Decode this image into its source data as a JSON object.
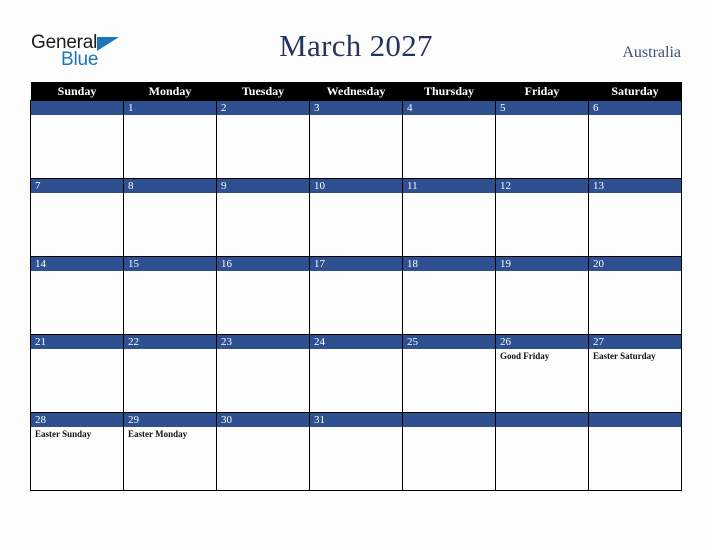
{
  "header": {
    "logo": {
      "top_text": "General",
      "bottom_text": "Blue",
      "triangle_color": "#1b75bc",
      "top_color": "#1c1c1c"
    },
    "title": "March 2027",
    "country": "Australia",
    "title_color": "#27355e"
  },
  "calendar": {
    "weekday_headers": [
      "Sunday",
      "Monday",
      "Tuesday",
      "Wednesday",
      "Thursday",
      "Friday",
      "Saturday"
    ],
    "header_bg": "#000000",
    "daybar_bg": "#2e5090",
    "weeks": [
      [
        {
          "day": "",
          "events": []
        },
        {
          "day": "1",
          "events": []
        },
        {
          "day": "2",
          "events": []
        },
        {
          "day": "3",
          "events": []
        },
        {
          "day": "4",
          "events": []
        },
        {
          "day": "5",
          "events": []
        },
        {
          "day": "6",
          "events": []
        }
      ],
      [
        {
          "day": "7",
          "events": []
        },
        {
          "day": "8",
          "events": []
        },
        {
          "day": "9",
          "events": []
        },
        {
          "day": "10",
          "events": []
        },
        {
          "day": "11",
          "events": []
        },
        {
          "day": "12",
          "events": []
        },
        {
          "day": "13",
          "events": []
        }
      ],
      [
        {
          "day": "14",
          "events": []
        },
        {
          "day": "15",
          "events": []
        },
        {
          "day": "16",
          "events": []
        },
        {
          "day": "17",
          "events": []
        },
        {
          "day": "18",
          "events": []
        },
        {
          "day": "19",
          "events": []
        },
        {
          "day": "20",
          "events": []
        }
      ],
      [
        {
          "day": "21",
          "events": []
        },
        {
          "day": "22",
          "events": []
        },
        {
          "day": "23",
          "events": []
        },
        {
          "day": "24",
          "events": []
        },
        {
          "day": "25",
          "events": []
        },
        {
          "day": "26",
          "events": [
            "Good Friday"
          ]
        },
        {
          "day": "27",
          "events": [
            "Easter Saturday"
          ]
        }
      ],
      [
        {
          "day": "28",
          "events": [
            "Easter Sunday"
          ]
        },
        {
          "day": "29",
          "events": [
            "Easter Monday"
          ]
        },
        {
          "day": "30",
          "events": []
        },
        {
          "day": "31",
          "events": []
        },
        {
          "day": "",
          "events": []
        },
        {
          "day": "",
          "events": []
        },
        {
          "day": "",
          "events": []
        }
      ]
    ]
  }
}
